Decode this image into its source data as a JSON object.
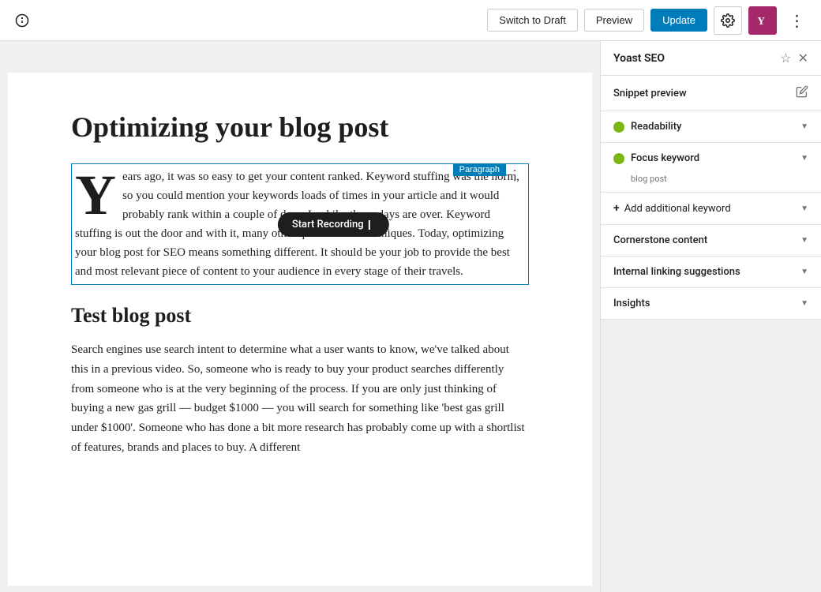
{
  "toolbar": {
    "info_icon": "ℹ",
    "switch_to_draft_label": "Switch to Draft",
    "preview_label": "Preview",
    "update_label": "Update",
    "settings_icon": "⚙",
    "yoast_icon": "Y",
    "more_icon": "⋮"
  },
  "editor": {
    "post_title": "Optimizing your blog post",
    "paragraph_label": "Paragraph",
    "drop_cap_letter": "Y",
    "paragraph_text": "ears ago, it was so easy to get your content ranked. Keyword stuffing was the norm, so you could mention your keywords loads of times in your article and it would probably rank within a couple of days. Luckily, those days are over. Keyword stuffing is out the door and with it, many other questionable techniques. Today, optimizing your blog post for SEO means something different. It should be your job to provide the best and most relevant piece of content to your audience in every stage of their travels.",
    "recording_label": "Start Recording",
    "section2_title": "Test blog post",
    "section2_text": "Search engines use search intent to determine what a user wants to know, we've talked about this in a previous video. So, someone who is ready to buy your product searches differently from someone who is at the very beginning of the process. If you are only just thinking of buying a new gas grill — budget $1000 — you will search for something like 'best gas grill under $1000'. Someone who has done a bit more research has probably come up with a shortlist of features, brands and places to buy. A different"
  },
  "yoast": {
    "panel_title": "Yoast SEO",
    "snippet_preview_label": "Snippet preview",
    "readability_label": "Readability",
    "focus_keyword_label": "Focus keyword",
    "focus_keyword_value": "blog post",
    "add_keyword_label": "Add additional keyword",
    "cornerstone_label": "Cornerstone content",
    "internal_linking_label": "Internal linking suggestions",
    "insights_label": "Insights"
  },
  "colors": {
    "primary_blue": "#007cba",
    "yoast_purple": "#a4286a",
    "green_dot": "#7cb518"
  }
}
